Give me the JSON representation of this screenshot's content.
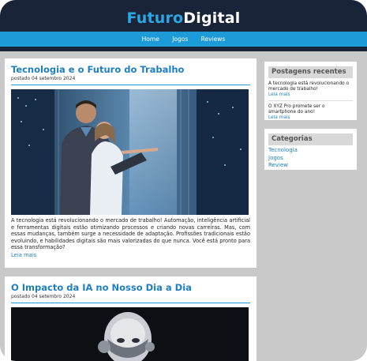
{
  "site": {
    "logo_part1": "Futuro",
    "logo_part2": "Digital"
  },
  "nav": {
    "items": [
      "Home",
      "Jogos",
      "Reviews"
    ]
  },
  "posts": [
    {
      "title": "Tecnologia e o Futuro do Trabalho",
      "date": "postado 04 setembro 2024",
      "excerpt": "A tecnologia está revolucionando o mercado de trabalho! Automação, inteligência artificial e ferramentas digitais estão otimizando processos e criando novas carreiras. Mas, com essas mudanças, também surge a necessidade de adaptação. Profissões tradicionais estão evoluindo, e habilidades digitais são mais valorizadas do que nunca. Você está pronto para essa transformação?",
      "read_more": "Leia mais"
    },
    {
      "title": "O Impacto da IA no Nosso Dia a Dia",
      "date": "postado 04 setembro 2024"
    }
  ],
  "sidebar": {
    "recent": {
      "title": "Postagens recentes",
      "items": [
        {
          "text": "A tecnologia está revolucionando o mercado de trabalho!",
          "link": "Leia mais"
        },
        {
          "text": "O XYZ Pro promete ser o smartphone do ano!",
          "link": "Leia mais"
        }
      ]
    },
    "categories": {
      "title": "Categorias",
      "items": [
        "Tecnologia",
        "Jogos",
        "Review"
      ]
    }
  }
}
